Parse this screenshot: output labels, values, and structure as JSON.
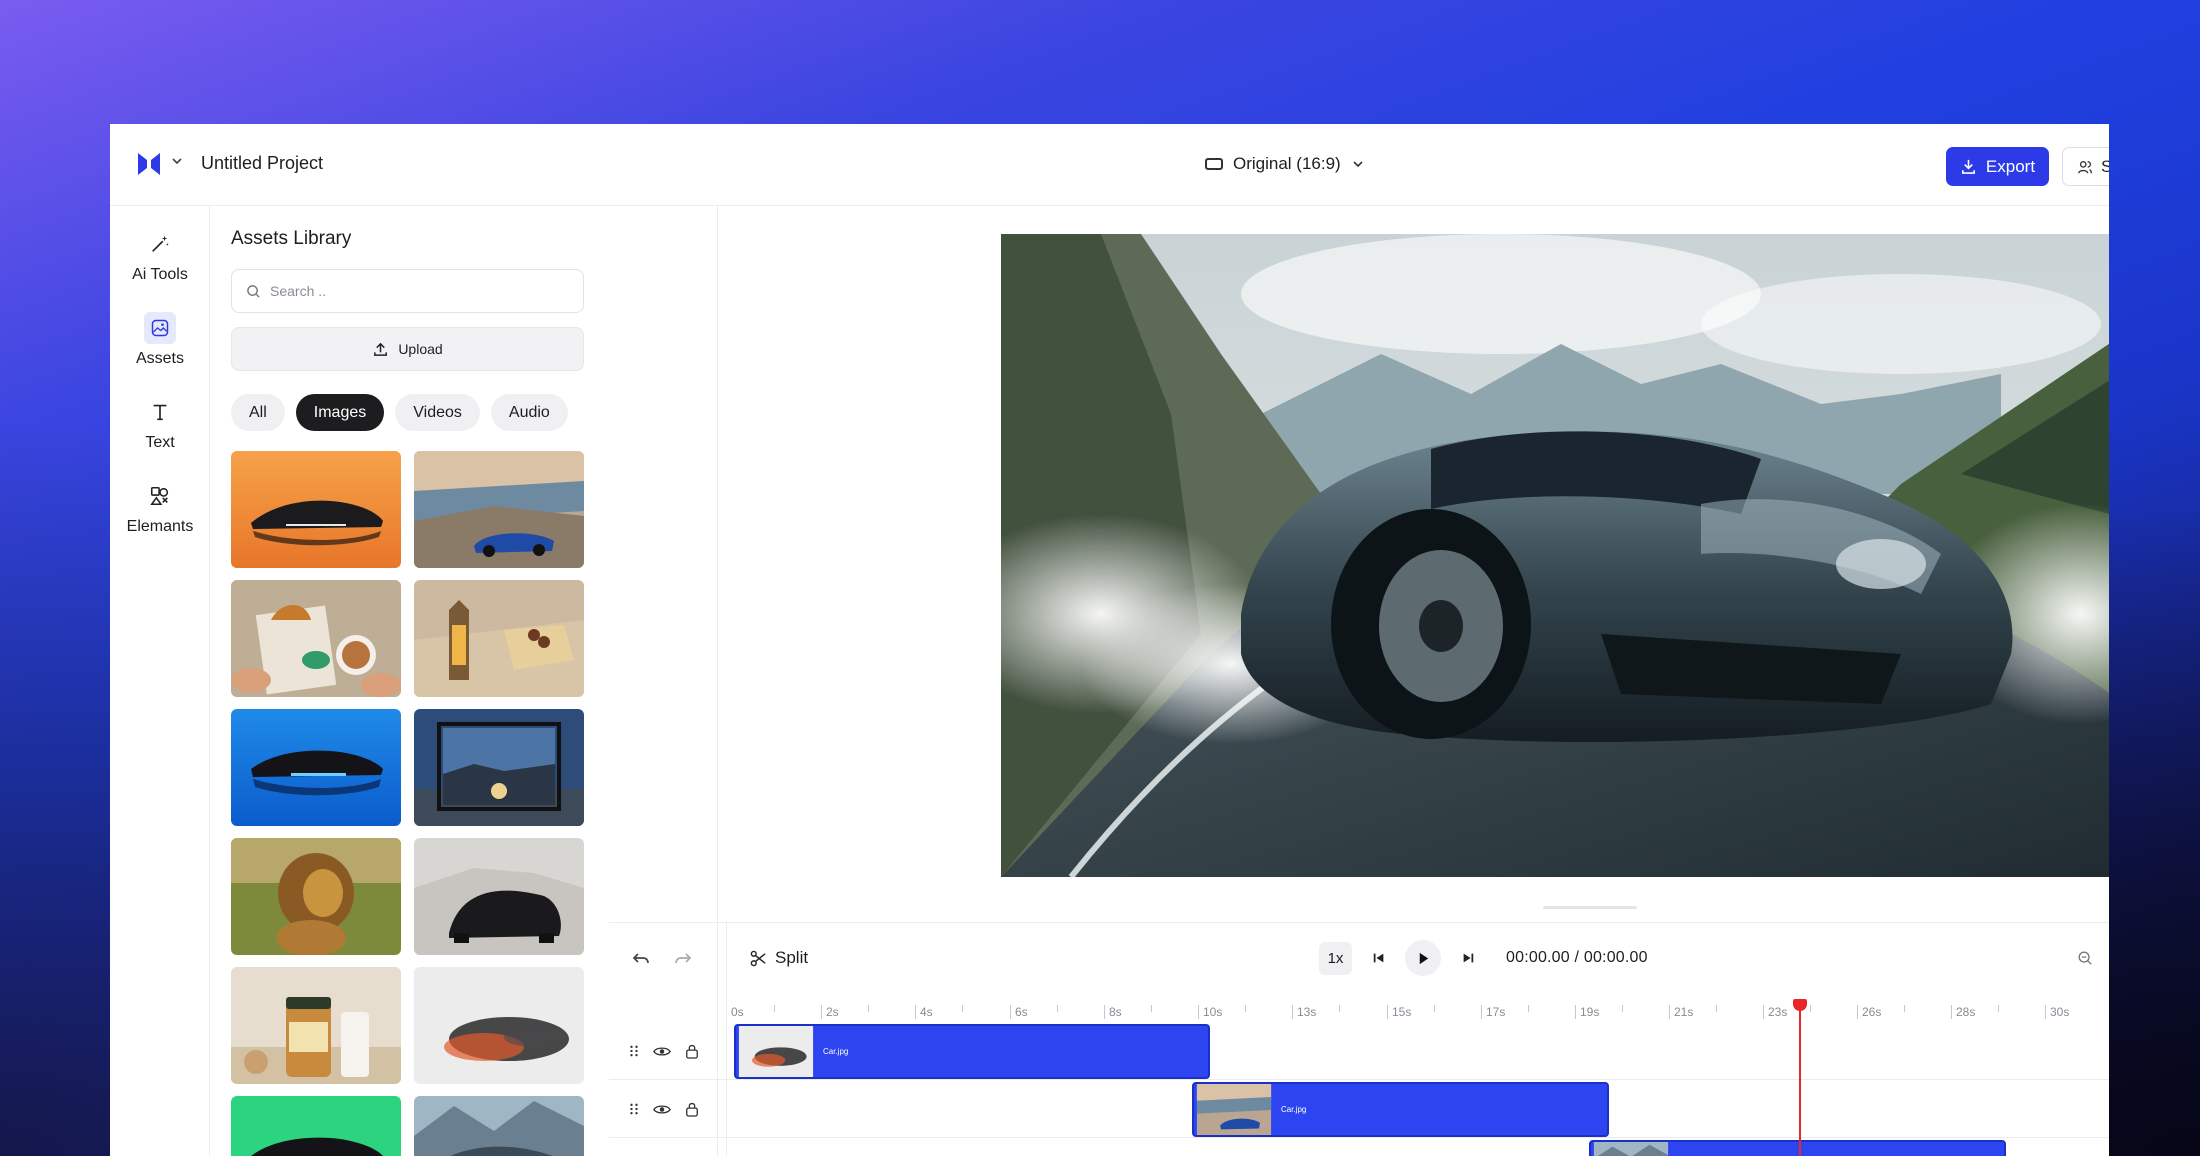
{
  "app": {
    "project_title": "Untitled Project",
    "aspect_ratio": "Original (16:9)",
    "export_label": "Export",
    "share_label": "S"
  },
  "rail": {
    "items": [
      {
        "label": "Ai Tools",
        "icon": "magic-wand-icon"
      },
      {
        "label": "Assets",
        "icon": "image-icon"
      },
      {
        "label": "Text",
        "icon": "text-icon"
      },
      {
        "label": "Elemants",
        "icon": "shapes-icon"
      }
    ]
  },
  "assets": {
    "title": "Assets Library",
    "search_placeholder": "Search ..",
    "upload_label": "Upload",
    "filters": [
      "All",
      "Images",
      "Videos",
      "Audio"
    ],
    "active_filter": "Images"
  },
  "timeline": {
    "split_label": "Split",
    "speed": "1x",
    "current_time": "00:00.00",
    "separator": "/",
    "total_time": "00:00.00",
    "ruler_labels": [
      "0s",
      "2s",
      "4s",
      "6s",
      "8s",
      "10s",
      "13s",
      "15s",
      "17s",
      "19s",
      "21s",
      "23s",
      "26s",
      "28s",
      "30s"
    ],
    "clips": [
      {
        "label": "Car.jpg"
      },
      {
        "label": "Car.jpg"
      },
      {
        "label": ""
      }
    ]
  },
  "colors": {
    "accent": "#2d3ae8",
    "clip": "#2d45f0",
    "playhead": "#e82828"
  }
}
